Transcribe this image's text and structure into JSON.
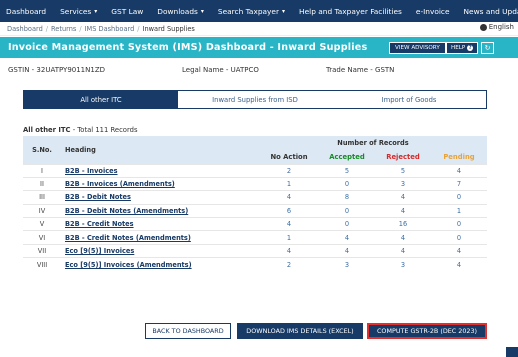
{
  "topnav": {
    "items": [
      {
        "label": "Dashboard",
        "caret": false
      },
      {
        "label": "Services",
        "caret": true
      },
      {
        "label": "GST Law",
        "caret": false
      },
      {
        "label": "Downloads",
        "caret": true
      },
      {
        "label": "Search Taxpayer",
        "caret": true
      },
      {
        "label": "Help and Taxpayer Facilities",
        "caret": false
      },
      {
        "label": "e-Invoice",
        "caret": false
      },
      {
        "label": "News and Updates",
        "caret": false
      }
    ],
    "caret_glyph": "▾"
  },
  "breadcrumb": {
    "items": [
      "Dashboard",
      "Returns",
      "IMS Dashboard",
      "Inward Supplies"
    ],
    "separator": "/",
    "language": "English"
  },
  "titlebar": {
    "title": "Invoice Management System (IMS) Dashboard - Inward Supplies",
    "view_advisory": "VIEW ADVISORY",
    "help": "HELP",
    "help_icon": "?",
    "refresh_icon": "↻"
  },
  "info": {
    "gstin": "GSTIN - 32UATPY9011N1ZD",
    "legal_name": "Legal Name - UATPCO",
    "trade_name": "Trade Name - GSTN"
  },
  "tabs": [
    {
      "label": "All other ITC",
      "active": true
    },
    {
      "label": "Inward Supplies from ISD",
      "active": false
    },
    {
      "label": "Import of Goods",
      "active": false
    }
  ],
  "records": {
    "label": "All other ITC",
    "total": " - Total 111 Records"
  },
  "table": {
    "headers": {
      "sno": "S.No.",
      "heading": "Heading",
      "number_of_records": "Number of Records",
      "no_action": "No Action",
      "accepted": "Accepted",
      "rejected": "Rejected",
      "pending": "Pending"
    },
    "rows": [
      {
        "sno": "I",
        "heading": "B2B - Invoices",
        "no_action": "2",
        "accepted": "5",
        "rejected": "5",
        "pending": "4"
      },
      {
        "sno": "II",
        "heading": "B2B - Invoices (Amendments)",
        "no_action": "1",
        "accepted": "0",
        "rejected": "3",
        "pending": "7"
      },
      {
        "sno": "III",
        "heading": "B2B - Debit Notes",
        "no_action": "4",
        "accepted": "8",
        "rejected": "4",
        "pending": "0"
      },
      {
        "sno": "IV",
        "heading": "B2B - Debit Notes (Amendments)",
        "no_action": "6",
        "accepted": "0",
        "rejected": "4",
        "pending": "1"
      },
      {
        "sno": "V",
        "heading": "B2B - Credit Notes",
        "no_action": "4",
        "accepted": "0",
        "rejected": "16",
        "pending": "0"
      },
      {
        "sno": "VI",
        "heading": "B2B - Credit Notes (Amendments)",
        "no_action": "1",
        "accepted": "4",
        "rejected": "4",
        "pending": "0"
      },
      {
        "sno": "VII",
        "heading": "Eco [9(5)] Invoices",
        "no_action": "4",
        "accepted": "4",
        "rejected": "4",
        "pending": "4"
      },
      {
        "sno": "VIII",
        "heading": "Eco [9(5)] Invoices (Amendments)",
        "no_action": "2",
        "accepted": "3",
        "rejected": "3",
        "pending": "4"
      }
    ]
  },
  "footer": {
    "back": "BACK TO DASHBOARD",
    "download": "DOWNLOAD IMS DETAILS (EXCEL)",
    "compute": "COMPUTE GSTR-2B (DEC 2023)"
  },
  "colors": {
    "navy": "#173a66",
    "teal": "#2ab5c7",
    "accepted": "#198a28",
    "rejected": "#d32b2b",
    "pending": "#e8a33b",
    "highlight": "#e03030"
  }
}
